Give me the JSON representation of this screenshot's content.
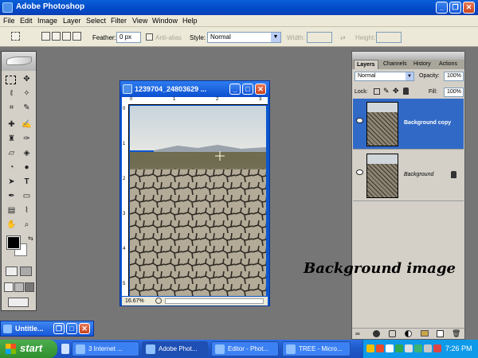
{
  "app": {
    "title": "Adobe Photoshop"
  },
  "menu": [
    "File",
    "Edit",
    "Image",
    "Layer",
    "Select",
    "Filter",
    "View",
    "Window",
    "Help"
  ],
  "options": {
    "feather_label": "Feather:",
    "feather_value": "0 px",
    "antialias_label": "Anti-alias",
    "style_label": "Style:",
    "style_value": "Normal",
    "width_label": "Width:",
    "height_label": "Height:"
  },
  "document": {
    "title": "1239704_24803629 ...",
    "zoom": "16.67%",
    "ruler_top": [
      "0",
      "1",
      "2",
      "3"
    ],
    "ruler_left": [
      "0",
      "1",
      "2",
      "3",
      "4",
      "5"
    ]
  },
  "layers_panel": {
    "tabs": [
      "Layers",
      "Channels",
      "History",
      "Actions"
    ],
    "blend_mode": "Normal",
    "opacity_label": "Opacity:",
    "opacity_value": "100%",
    "lock_label": "Lock:",
    "fill_label": "Fill:",
    "fill_value": "100%",
    "layers": [
      {
        "name": "Background copy"
      },
      {
        "name": "Background"
      }
    ]
  },
  "annotation": "Background image",
  "minimized_window": {
    "title": "Untitle..."
  },
  "taskbar": {
    "start_label": "start",
    "buttons": [
      {
        "label": "3 Internet ..."
      },
      {
        "label": "Adobe Phot..."
      },
      {
        "label": "Editor - Phot..."
      },
      {
        "label": "TREE - Micro..."
      }
    ],
    "clock": "7:26 PM"
  },
  "colors": {
    "title_bar": "#0a5fd8",
    "workspace": "#767676",
    "panel": "#d4d0c8",
    "selected_layer": "#3169c6",
    "taskbar": "#1e58c8",
    "start_button": "#3c9a3c"
  }
}
